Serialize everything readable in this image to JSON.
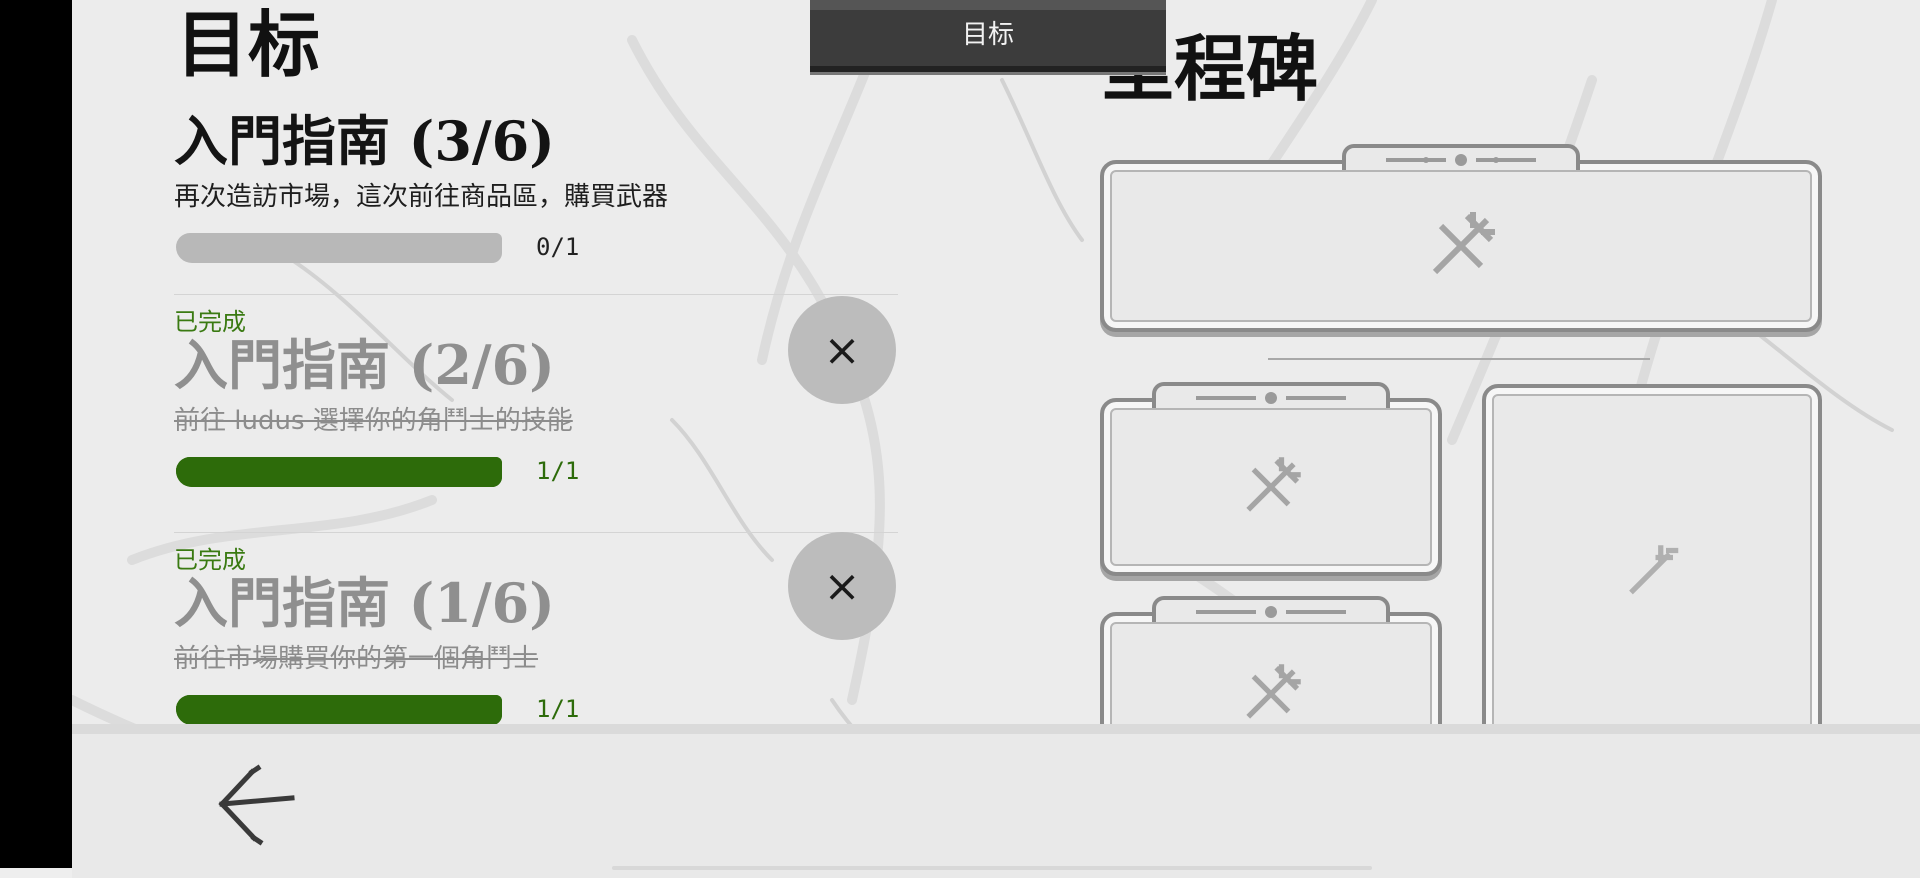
{
  "header": {
    "objectives_title": "目标",
    "milestones_title": "里程碑",
    "top_tab_label": "目标"
  },
  "quests": [
    {
      "status": "",
      "title": "入門指南 (3/6)",
      "description": "再次造訪市場，這次前往商品區，購買武器",
      "progress_text": "0/1",
      "progress_value": 0,
      "completed": false
    },
    {
      "status": "已完成",
      "title": "入門指南 (2/6)",
      "description": "前往 ludus 選擇你的角鬥士的技能",
      "progress_text": "1/1",
      "progress_value": 1,
      "completed": true,
      "dismiss_label": "×"
    },
    {
      "status": "已完成",
      "title": "入門指南 (1/6)",
      "description": "前往市場購買你的第一個角鬥士",
      "progress_text": "1/1",
      "progress_value": 1,
      "completed": true,
      "dismiss_label": "×"
    }
  ],
  "icons": {
    "back": "back-arrow-icon",
    "dismiss": "close-icon",
    "milestone_emblem": "crossed-swords-trident-icon"
  },
  "colors": {
    "completed_green": "#2d6b0a",
    "inactive_gray": "#b8b8b8",
    "tab_background": "#3c3c3c"
  }
}
